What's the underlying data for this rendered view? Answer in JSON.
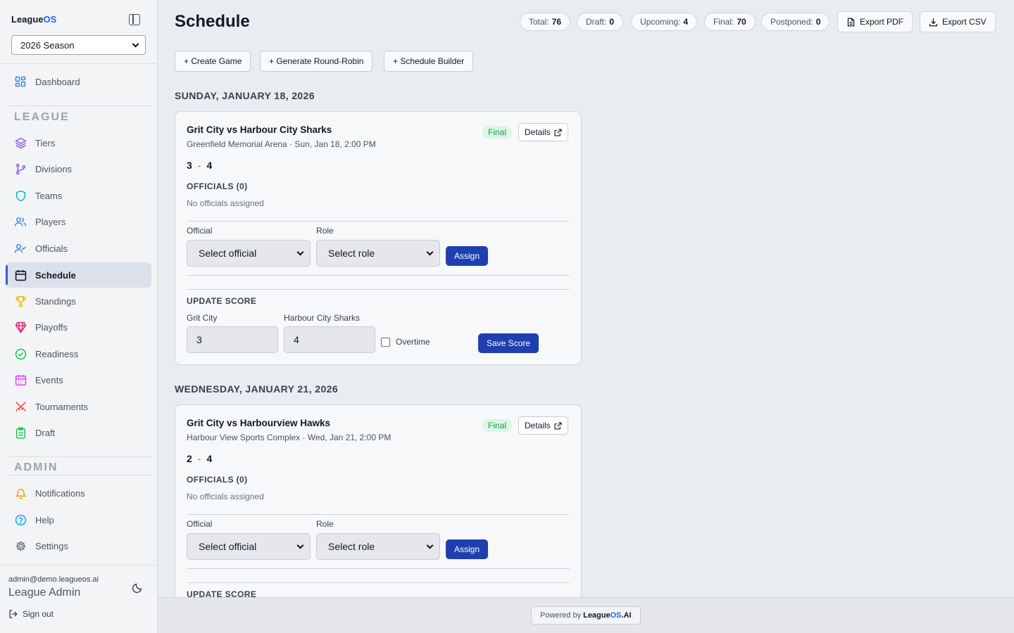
{
  "sidebar": {
    "brand": {
      "league": "League",
      "os": "OS"
    },
    "season": "2026 Season",
    "dashboard": "Dashboard",
    "league_section": "LEAGUE",
    "league_items": [
      "Tiers",
      "Divisions",
      "Teams",
      "Players",
      "Officials",
      "Schedule",
      "Standings",
      "Playoffs",
      "Readiness",
      "Events",
      "Tournaments",
      "Draft"
    ],
    "admin_section": "ADMIN",
    "admin_items": [
      "Notifications",
      "Help",
      "Settings"
    ],
    "active_item": "Schedule",
    "user_email": "admin@demo.leagueos.ai",
    "user_name": "League Admin",
    "sign_out": "Sign out"
  },
  "header": {
    "title": "Schedule",
    "stats": [
      {
        "label": "Total:",
        "value": "76"
      },
      {
        "label": "Draft:",
        "value": "0"
      },
      {
        "label": "Upcoming:",
        "value": "4"
      },
      {
        "label": "Final:",
        "value": "70"
      },
      {
        "label": "Postponed:",
        "value": "0"
      }
    ],
    "export_pdf": "Export PDF",
    "export_csv": "Export CSV"
  },
  "actions": {
    "create_game": "+ Create Game",
    "round_robin": "+ Generate Round-Robin",
    "builder": "+ Schedule Builder"
  },
  "days": [
    {
      "date": "SUNDAY, JANUARY 18, 2026",
      "game": {
        "title": "Grit City vs Harbour City Sharks",
        "subtitle": "Greenfield Memorial Arena · Sun, Jan 18, 2:00 PM",
        "status": "Final",
        "details": "Details",
        "home_score": "3",
        "away_score": "4",
        "score_sep": "-",
        "officials_title": "OFFICIALS (0)",
        "officials_empty": "No officials assigned",
        "official_label": "Official",
        "official_placeholder": "Select official",
        "role_label": "Role",
        "role_placeholder": "Select role",
        "assign": "Assign",
        "update_title": "UPDATE SCORE",
        "home_team": "Grit City",
        "away_team": "Harbour City Sharks",
        "home_value": "3",
        "away_value": "4",
        "overtime": "Overtime",
        "save": "Save Score"
      }
    },
    {
      "date": "WEDNESDAY, JANUARY 21, 2026",
      "game": {
        "title": "Grit City vs Harbourview Hawks",
        "subtitle": "Harbour View Sports Complex · Wed, Jan 21, 2:00 PM",
        "status": "Final",
        "details": "Details",
        "home_score": "2",
        "away_score": "4",
        "score_sep": "-",
        "officials_title": "OFFICIALS (0)",
        "officials_empty": "No officials assigned",
        "official_label": "Official",
        "official_placeholder": "Select official",
        "role_label": "Role",
        "role_placeholder": "Select role",
        "assign": "Assign",
        "update_title": "UPDATE SCORE"
      }
    }
  ],
  "footer": {
    "powered_by": "Powered by",
    "brand_league": "League",
    "brand_os": "OS",
    "brand_ai": ".AI"
  },
  "colors": {
    "primary": "#1e40af",
    "accent": "#3b5ccc",
    "final_badge": "#16a34a"
  }
}
